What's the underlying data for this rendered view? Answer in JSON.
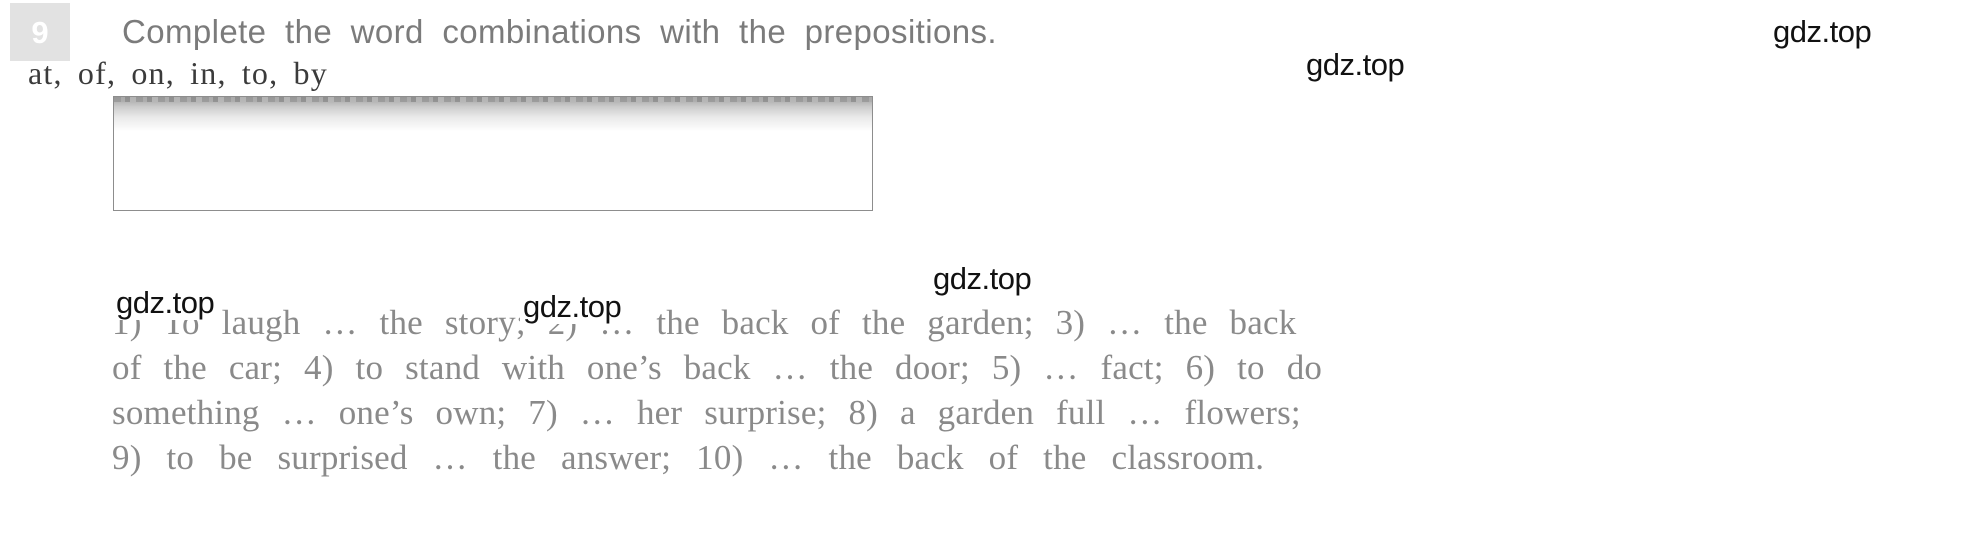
{
  "exercise": {
    "number": "9",
    "instruction": "Complete the word combinations with the prepositions."
  },
  "prepositions_box": {
    "words": "at, of, on, in, to, by"
  },
  "body": {
    "lines": [
      "1) To laugh … the story; 2) … the back of the garden; 3) … the back",
      "of the car; 4) to stand with one’s back … the door; 5) … fact; 6) to do",
      "something … one’s own; 7) … her surprise; 8) a garden full … flowers;",
      "9) to be surprised … the answer; 10) … the back of the classroom."
    ],
    "items": [
      {
        "number": "1)",
        "text": "To laugh … the story;"
      },
      {
        "number": "2)",
        "text": "… the back of the garden;"
      },
      {
        "number": "3)",
        "text": "… the back of the car;"
      },
      {
        "number": "4)",
        "text": "to stand with one’s back … the door;"
      },
      {
        "number": "5)",
        "text": "… fact;"
      },
      {
        "number": "6)",
        "text": "to do something … one’s own;"
      },
      {
        "number": "7)",
        "text": "… her surprise;"
      },
      {
        "number": "8)",
        "text": "a garden full … flowers;"
      },
      {
        "number": "9)",
        "text": "to be surprised … the answer;"
      },
      {
        "number": "10)",
        "text": "… the back of the classroom."
      }
    ]
  },
  "watermarks": [
    {
      "id": "wm-1",
      "text": "gdz.top"
    },
    {
      "id": "wm-2",
      "text": "gdz.top"
    },
    {
      "id": "wm-3",
      "text": "gdz.top"
    },
    {
      "id": "wm-4",
      "text": "gdz.top"
    },
    {
      "id": "wm-5",
      "text": "gdz.top"
    }
  ],
  "colors": {
    "badge_background": "#e2e2e2",
    "badge_number": "#ffffff",
    "instruction_text": "#7b7b7b",
    "box_border": "#8d8d8d",
    "box_band": "#9a9a9a",
    "box_text": "#3b3b3b",
    "body_text": "#8a8a8a",
    "watermark_text": "#111111",
    "page_background": "#ffffff"
  }
}
